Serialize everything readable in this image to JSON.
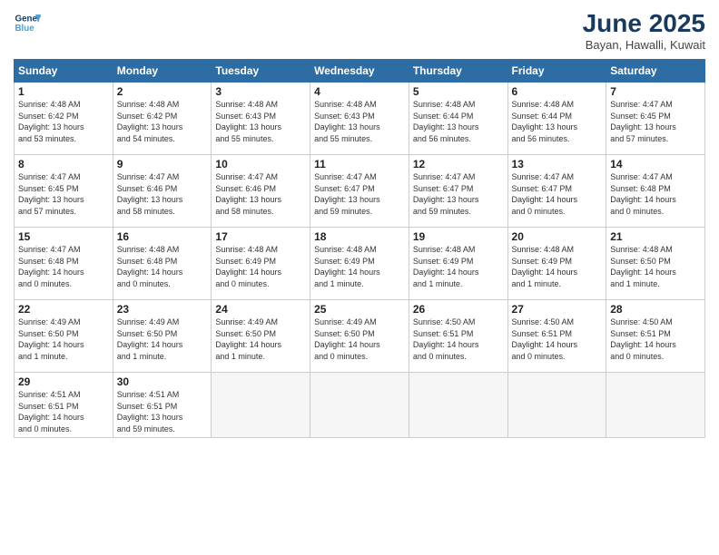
{
  "header": {
    "logo_line1": "General",
    "logo_line2": "Blue",
    "month_title": "June 2025",
    "location": "Bayan, Hawalli, Kuwait"
  },
  "days_of_week": [
    "Sunday",
    "Monday",
    "Tuesday",
    "Wednesday",
    "Thursday",
    "Friday",
    "Saturday"
  ],
  "weeks": [
    [
      {
        "day": "1",
        "info": "Sunrise: 4:48 AM\nSunset: 6:42 PM\nDaylight: 13 hours\nand 53 minutes."
      },
      {
        "day": "2",
        "info": "Sunrise: 4:48 AM\nSunset: 6:42 PM\nDaylight: 13 hours\nand 54 minutes."
      },
      {
        "day": "3",
        "info": "Sunrise: 4:48 AM\nSunset: 6:43 PM\nDaylight: 13 hours\nand 55 minutes."
      },
      {
        "day": "4",
        "info": "Sunrise: 4:48 AM\nSunset: 6:43 PM\nDaylight: 13 hours\nand 55 minutes."
      },
      {
        "day": "5",
        "info": "Sunrise: 4:48 AM\nSunset: 6:44 PM\nDaylight: 13 hours\nand 56 minutes."
      },
      {
        "day": "6",
        "info": "Sunrise: 4:48 AM\nSunset: 6:44 PM\nDaylight: 13 hours\nand 56 minutes."
      },
      {
        "day": "7",
        "info": "Sunrise: 4:47 AM\nSunset: 6:45 PM\nDaylight: 13 hours\nand 57 minutes."
      }
    ],
    [
      {
        "day": "8",
        "info": "Sunrise: 4:47 AM\nSunset: 6:45 PM\nDaylight: 13 hours\nand 57 minutes."
      },
      {
        "day": "9",
        "info": "Sunrise: 4:47 AM\nSunset: 6:46 PM\nDaylight: 13 hours\nand 58 minutes."
      },
      {
        "day": "10",
        "info": "Sunrise: 4:47 AM\nSunset: 6:46 PM\nDaylight: 13 hours\nand 58 minutes."
      },
      {
        "day": "11",
        "info": "Sunrise: 4:47 AM\nSunset: 6:47 PM\nDaylight: 13 hours\nand 59 minutes."
      },
      {
        "day": "12",
        "info": "Sunrise: 4:47 AM\nSunset: 6:47 PM\nDaylight: 13 hours\nand 59 minutes."
      },
      {
        "day": "13",
        "info": "Sunrise: 4:47 AM\nSunset: 6:47 PM\nDaylight: 14 hours\nand 0 minutes."
      },
      {
        "day": "14",
        "info": "Sunrise: 4:47 AM\nSunset: 6:48 PM\nDaylight: 14 hours\nand 0 minutes."
      }
    ],
    [
      {
        "day": "15",
        "info": "Sunrise: 4:47 AM\nSunset: 6:48 PM\nDaylight: 14 hours\nand 0 minutes."
      },
      {
        "day": "16",
        "info": "Sunrise: 4:48 AM\nSunset: 6:48 PM\nDaylight: 14 hours\nand 0 minutes."
      },
      {
        "day": "17",
        "info": "Sunrise: 4:48 AM\nSunset: 6:49 PM\nDaylight: 14 hours\nand 0 minutes."
      },
      {
        "day": "18",
        "info": "Sunrise: 4:48 AM\nSunset: 6:49 PM\nDaylight: 14 hours\nand 1 minute."
      },
      {
        "day": "19",
        "info": "Sunrise: 4:48 AM\nSunset: 6:49 PM\nDaylight: 14 hours\nand 1 minute."
      },
      {
        "day": "20",
        "info": "Sunrise: 4:48 AM\nSunset: 6:49 PM\nDaylight: 14 hours\nand 1 minute."
      },
      {
        "day": "21",
        "info": "Sunrise: 4:48 AM\nSunset: 6:50 PM\nDaylight: 14 hours\nand 1 minute."
      }
    ],
    [
      {
        "day": "22",
        "info": "Sunrise: 4:49 AM\nSunset: 6:50 PM\nDaylight: 14 hours\nand 1 minute."
      },
      {
        "day": "23",
        "info": "Sunrise: 4:49 AM\nSunset: 6:50 PM\nDaylight: 14 hours\nand 1 minute."
      },
      {
        "day": "24",
        "info": "Sunrise: 4:49 AM\nSunset: 6:50 PM\nDaylight: 14 hours\nand 1 minute."
      },
      {
        "day": "25",
        "info": "Sunrise: 4:49 AM\nSunset: 6:50 PM\nDaylight: 14 hours\nand 0 minutes."
      },
      {
        "day": "26",
        "info": "Sunrise: 4:50 AM\nSunset: 6:51 PM\nDaylight: 14 hours\nand 0 minutes."
      },
      {
        "day": "27",
        "info": "Sunrise: 4:50 AM\nSunset: 6:51 PM\nDaylight: 14 hours\nand 0 minutes."
      },
      {
        "day": "28",
        "info": "Sunrise: 4:50 AM\nSunset: 6:51 PM\nDaylight: 14 hours\nand 0 minutes."
      }
    ],
    [
      {
        "day": "29",
        "info": "Sunrise: 4:51 AM\nSunset: 6:51 PM\nDaylight: 14 hours\nand 0 minutes."
      },
      {
        "day": "30",
        "info": "Sunrise: 4:51 AM\nSunset: 6:51 PM\nDaylight: 13 hours\nand 59 minutes."
      },
      {
        "day": "",
        "info": ""
      },
      {
        "day": "",
        "info": ""
      },
      {
        "day": "",
        "info": ""
      },
      {
        "day": "",
        "info": ""
      },
      {
        "day": "",
        "info": ""
      }
    ]
  ]
}
